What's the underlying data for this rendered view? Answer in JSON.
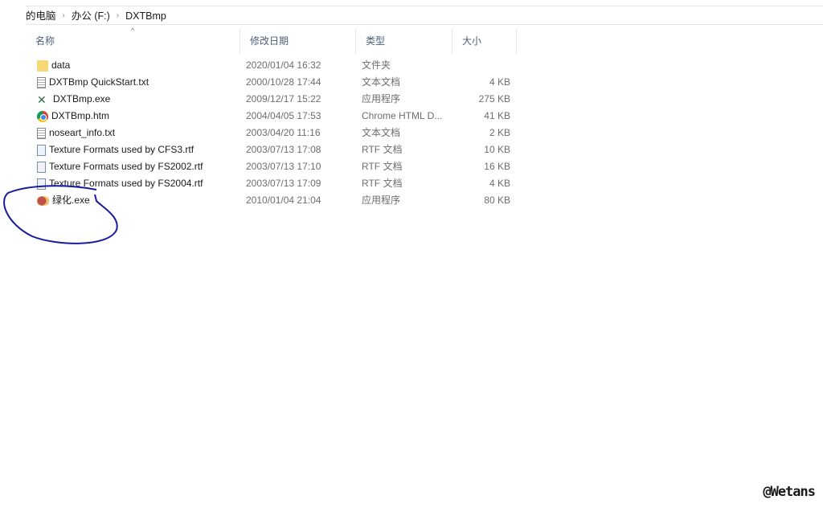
{
  "breadcrumb": [
    "的电脑",
    "办公 (F:)",
    "DXTBmp"
  ],
  "columns": [
    "名称",
    "修改日期",
    "类型",
    "大小"
  ],
  "files": [
    {
      "name": "data",
      "date": "2020/01/04 16:32",
      "type": "文件夹",
      "size": "",
      "icon": "folder-icon"
    },
    {
      "name": "DXTBmp QuickStart.txt",
      "date": "2000/10/28 17:44",
      "type": "文本文档",
      "size": "4 KB",
      "icon": "text-file-icon"
    },
    {
      "name": "DXTBmp.exe",
      "date": "2009/12/17 15:22",
      "type": "应用程序",
      "size": "275 KB",
      "icon": "exe-icon"
    },
    {
      "name": "DXTBmp.htm",
      "date": "2004/04/05 17:53",
      "type": "Chrome HTML D...",
      "size": "41 KB",
      "icon": "chrome-icon"
    },
    {
      "name": "noseart_info.txt",
      "date": "2003/04/20 11:16",
      "type": "文本文档",
      "size": "2 KB",
      "icon": "text-file-icon"
    },
    {
      "name": "Texture Formats used by CFS3.rtf",
      "date": "2003/07/13 17:08",
      "type": "RTF 文档",
      "size": "10 KB",
      "icon": "rtf-icon"
    },
    {
      "name": "Texture Formats used by FS2002.rtf",
      "date": "2003/07/13 17:10",
      "type": "RTF 文档",
      "size": "16 KB",
      "icon": "rtf-icon"
    },
    {
      "name": "Texture Formats used by FS2004.rtf",
      "date": "2003/07/13 17:09",
      "type": "RTF 文档",
      "size": "4 KB",
      "icon": "rtf-icon"
    },
    {
      "name": "绿化.exe",
      "date": "2010/01/04 21:04",
      "type": "应用程序",
      "size": "80 KB",
      "icon": "app-icon"
    }
  ],
  "watermark": "@Wetans",
  "annotation_color": "#1a1aa0"
}
